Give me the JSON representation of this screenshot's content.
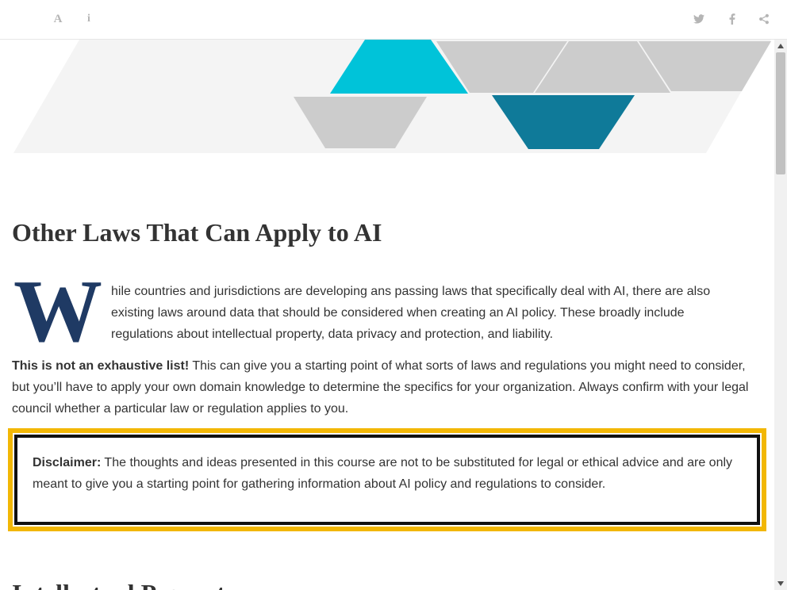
{
  "toolbar": {
    "font_icon_glyph": "A",
    "info_icon_glyph": "i",
    "icons": [
      "font-size-icon",
      "info-icon",
      "twitter-icon",
      "facebook-icon",
      "share-icon"
    ]
  },
  "article": {
    "heading": "Other Laws That Can Apply to AI",
    "dropcap": "W",
    "intro": "hile countries and jurisdictions are developing ans passing laws that specifically deal with AI, there are also existing laws around data that should be considered when creating an AI policy. These broadly include regulations about intellectual property, data privacy and protection, and liability.",
    "note_bold": "This is not an exhaustive list!",
    "note_text": " This can give you a starting point of what sorts of laws and regulations you might need to consider, but you’ll have to apply your own domain knowledge to determine the specifics for your organization. Always confirm with your legal council whether a particular law or regulation applies to you.",
    "disclaimer_label": "Disclaimer:",
    "disclaimer_text": " The thoughts and ideas presented in this course are not to be substituted for legal or ethical advice and are only meant to give you a starting point for gathering information about AI policy and regulations to consider.",
    "next_heading": "Intellectual Property"
  },
  "colors": {
    "accent_cyan": "#00c3d9",
    "accent_teal": "#0f7a99",
    "dropcap_navy": "#1f3a64",
    "callout_border": "#f2b705",
    "callout_inner_border": "#111111",
    "shape_gray": "#cccccc",
    "band_gray": "#f4f4f4"
  }
}
